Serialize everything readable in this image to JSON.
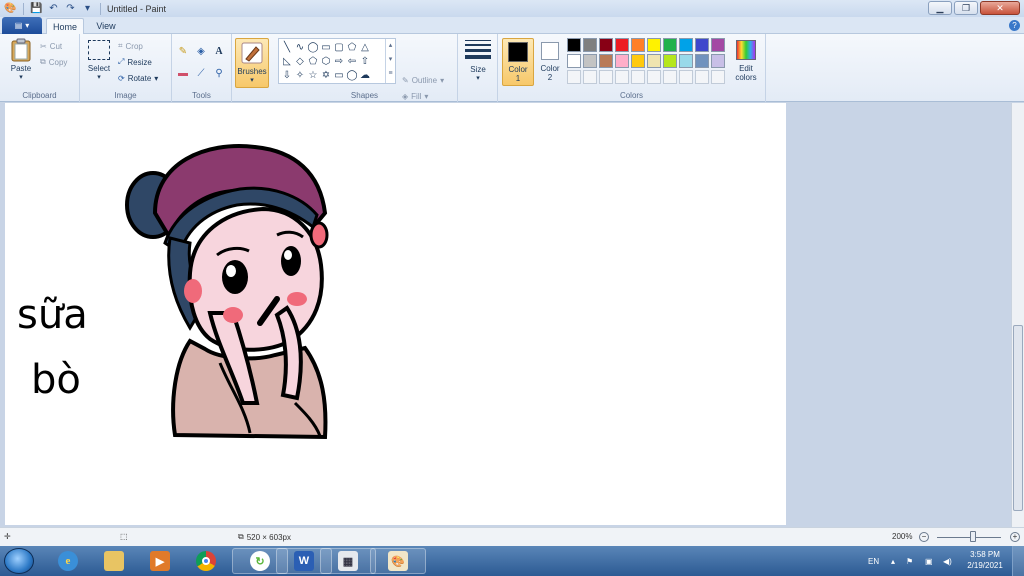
{
  "window": {
    "title": "Untitled - Paint"
  },
  "tabs": {
    "home": "Home",
    "view": "View"
  },
  "clipboard": {
    "paste": "Paste",
    "cut": "Cut",
    "copy": "Copy",
    "group": "Clipboard"
  },
  "image": {
    "select": "Select",
    "crop": "Crop",
    "resize": "Resize",
    "rotate": "Rotate",
    "group": "Image"
  },
  "tools": {
    "group": "Tools"
  },
  "brushes": {
    "label": "Brushes"
  },
  "shapes": {
    "outline": "Outline",
    "fill": "Fill",
    "group": "Shapes"
  },
  "size": {
    "label": "Size"
  },
  "colors": {
    "color1_label": "Color",
    "color1_num": "1",
    "color2_label": "Color",
    "color2_num": "2",
    "edit_label": "Edit",
    "edit_label2": "colors",
    "group": "Colors",
    "color1": "#000000",
    "color2": "#ffffff",
    "palette_row1": [
      "#000000",
      "#7f7f7f",
      "#880015",
      "#ed1c24",
      "#ff7f27",
      "#fff200",
      "#22b14c",
      "#00a2e8",
      "#3f48cc",
      "#a349a4"
    ],
    "palette_row2": [
      "#ffffff",
      "#c3c3c3",
      "#b97a57",
      "#ffaec9",
      "#ffc90e",
      "#efe4b0",
      "#b5e61d",
      "#99d9ea",
      "#7092be",
      "#c8bfe7"
    ]
  },
  "drawing": {
    "text_line1": "sữa",
    "text_line2": "bò",
    "colors": {
      "hat": "#8b3a6e",
      "hair": "#2f4766",
      "skin": "#f7d5dd",
      "blush": "#f06a7a",
      "shirt": "#d9b3ad",
      "outline": "#000000"
    }
  },
  "status": {
    "image_size": "520 × 603px",
    "zoom": "200%"
  },
  "tray": {
    "lang": "EN",
    "time": "3:58 PM",
    "date": "2/19/2021"
  }
}
